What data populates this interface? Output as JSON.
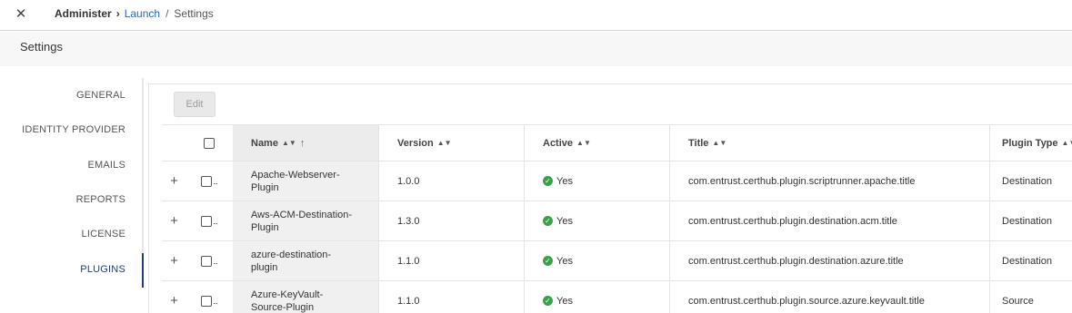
{
  "topbar": {
    "close_icon": "close-icon",
    "breadcrumb": {
      "root": "Administer",
      "link": "Launch",
      "current": "Settings"
    }
  },
  "page": {
    "title": "Settings"
  },
  "sidebar": {
    "items": [
      {
        "label": "GENERAL",
        "active": false
      },
      {
        "label": "IDENTITY PROVIDER",
        "active": false
      },
      {
        "label": "EMAILS",
        "active": false
      },
      {
        "label": "REPORTS",
        "active": false
      },
      {
        "label": "LICENSE",
        "active": false
      },
      {
        "label": "PLUGINS",
        "active": true
      }
    ]
  },
  "toolbar": {
    "edit_label": "Edit",
    "edit_disabled": true
  },
  "table": {
    "columns": {
      "name": "Name",
      "version": "Version",
      "active": "Active",
      "title": "Title",
      "plugin_type": "Plugin Type"
    },
    "rows": [
      {
        "name": "Apache-Webserver-Plugin",
        "version": "1.0.0",
        "active": "Yes",
        "title": "com.entrust.certhub.plugin.scriptrunner.apache.title",
        "plugin_type": "Destination"
      },
      {
        "name": "Aws-ACM-Destination-Plugin",
        "version": "1.3.0",
        "active": "Yes",
        "title": "com.entrust.certhub.plugin.destination.acm.title",
        "plugin_type": "Destination"
      },
      {
        "name": "azure-destination-plugin",
        "version": "1.1.0",
        "active": "Yes",
        "title": "com.entrust.certhub.plugin.destination.azure.title",
        "plugin_type": "Destination"
      },
      {
        "name": "Azure-KeyVault-Source-Plugin",
        "version": "1.1.0",
        "active": "Yes",
        "title": "com.entrust.certhub.plugin.source.azure.keyvault.title",
        "plugin_type": "Source"
      }
    ]
  },
  "colors": {
    "accent": "#1d3f77",
    "link": "#2a6ab7",
    "success": "#3aa14a"
  }
}
